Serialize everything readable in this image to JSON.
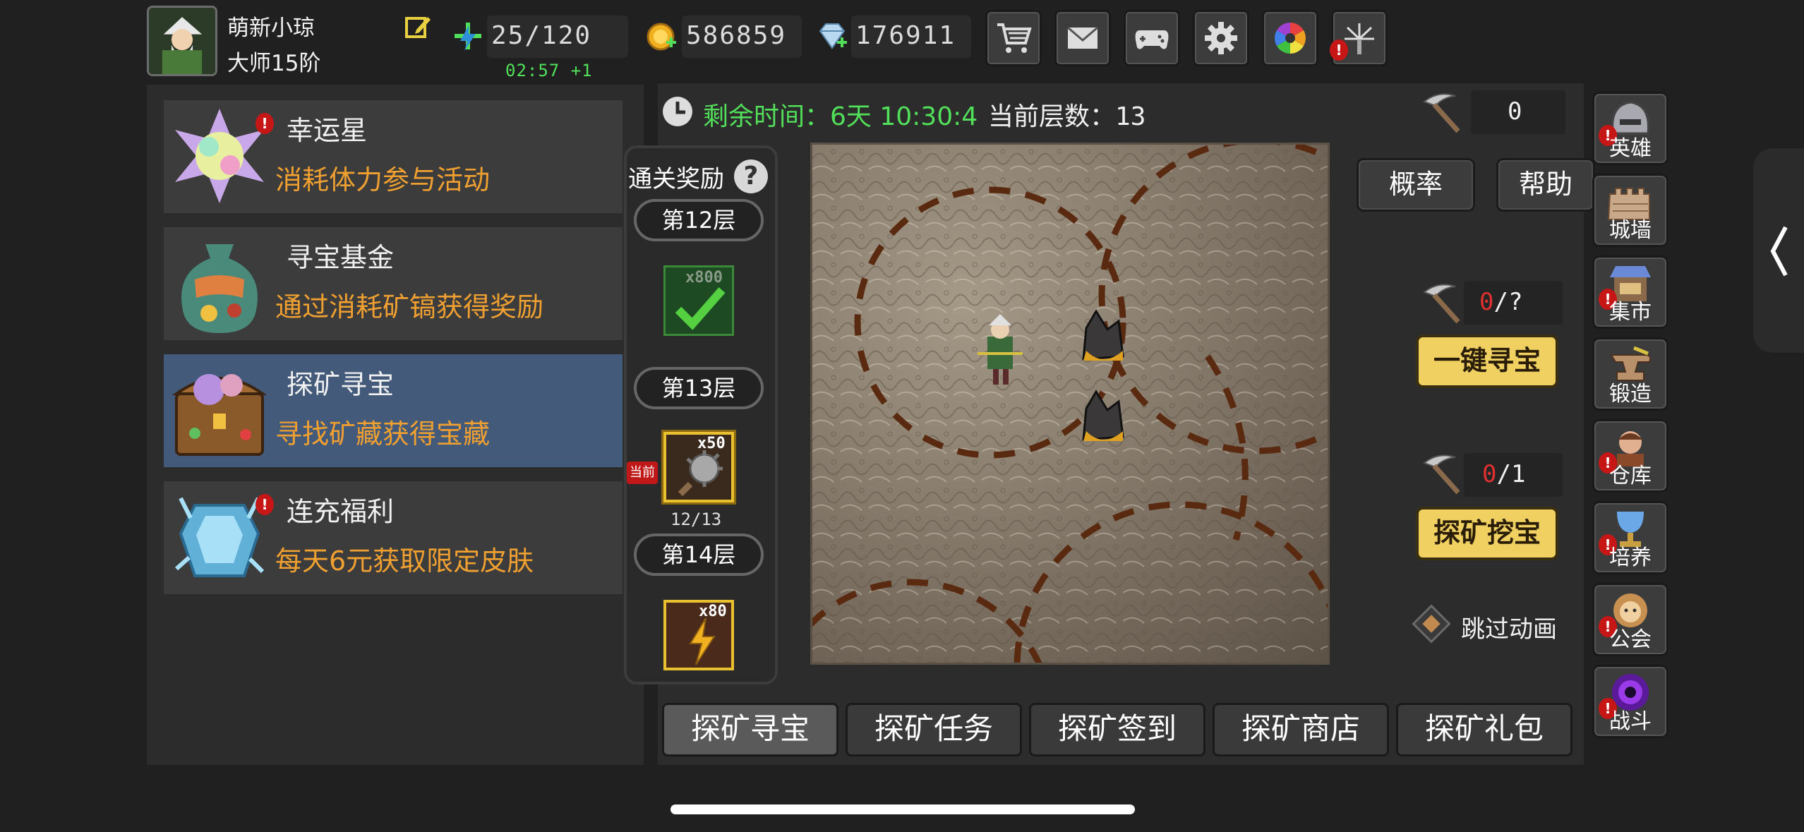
{
  "player": {
    "name": "萌新小琼",
    "rank": "大师15阶"
  },
  "resources": {
    "stamina": "25/120",
    "regen_timer": "02:57 +1",
    "gold": "586859",
    "gems": "176911"
  },
  "toolbar_icons": [
    "cart-icon",
    "mail-icon",
    "gamepad-icon",
    "gear-icon",
    "color-wheel-icon",
    "firework-icon"
  ],
  "menu": [
    {
      "title": "幸运星",
      "desc": "消耗体力参与活动",
      "alert": "!"
    },
    {
      "title": "寻宝基金",
      "desc": "通过消耗矿镐获得奖励"
    },
    {
      "title": "探矿寻宝",
      "desc": "寻找矿藏获得宝藏",
      "active": true
    },
    {
      "title": "连充福利",
      "desc": "每天6元获取限定皮肤",
      "alert": "!"
    }
  ],
  "event": {
    "remaining_label": "剩余时间：",
    "remaining_value": "6天 10:30:4",
    "floor_label": "当前层数：",
    "floor_value": "13"
  },
  "rewards": {
    "title": "通关奖励",
    "help": "?",
    "current_tag": "当前",
    "floors": [
      {
        "label": "第12层",
        "count": "x800"
      },
      {
        "label": "第13层",
        "count": "x50",
        "progress": "12/13"
      },
      {
        "label": "第14层",
        "count": "x80"
      }
    ]
  },
  "pickaxe_total": "0",
  "buttons": {
    "odds": "概率",
    "help": "帮助",
    "auto": {
      "used": "0",
      "sep": "/",
      "max": "?",
      "label": "一键寻宝"
    },
    "dig": {
      "used": "0",
      "sep": "/",
      "max": "1",
      "label": "探矿挖宝"
    },
    "skip": "跳过动画"
  },
  "tabs": [
    "探矿寻宝",
    "探矿任务",
    "探矿签到",
    "探矿商店",
    "探矿礼包"
  ],
  "side_nav": [
    {
      "label": "英雄",
      "alert": "!"
    },
    {
      "label": "城墙"
    },
    {
      "label": "集市",
      "alert": "!"
    },
    {
      "label": "锻造"
    },
    {
      "label": "仓库",
      "alert": "!"
    },
    {
      "label": "培养",
      "alert": "!"
    },
    {
      "label": "公会",
      "alert": "!"
    },
    {
      "label": "战斗",
      "alert": "!"
    }
  ],
  "colors": {
    "green": "#52e05a",
    "orange": "#f0a030",
    "yellow": "#f0d060",
    "red": "#e03030",
    "active_blue": "#445a7a"
  }
}
